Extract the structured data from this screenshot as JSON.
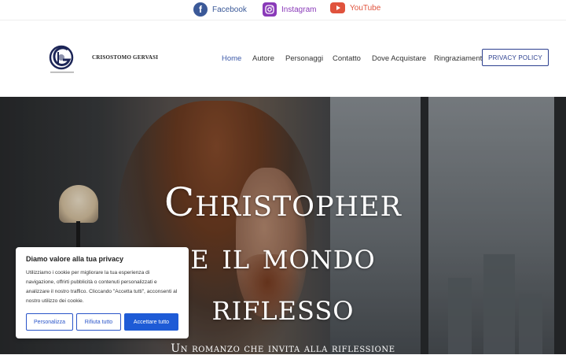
{
  "social": [
    {
      "label": "Facebook",
      "icon": "facebook-icon",
      "color": "#3b5998"
    },
    {
      "label": "Instagram",
      "icon": "instagram-icon",
      "color": "#8a3ab9"
    },
    {
      "label": "YouTube",
      "icon": "youtube-icon",
      "color": "#e0533d"
    }
  ],
  "header": {
    "brand": "CRISOSTOMO GERVASI",
    "nav": [
      "Home",
      "Autore",
      "Personaggi",
      "Contatto",
      "Dove Acquistare",
      "Ringraziamenti"
    ],
    "active_nav": "Home",
    "privacy_button": "PRIVACY POLICY"
  },
  "hero": {
    "title_lines": [
      "Christopher",
      "e il mondo",
      "riflesso"
    ],
    "subtitle": "Un romanzo che invita alla riflessione"
  },
  "cookie": {
    "title": "Diamo valore alla tua privacy",
    "text": "Utilizziamo i cookie per migliorare la tua esperienza di navigazione, offrirti pubblicità o contenuti personalizzati e analizzare il nostro traffico. Cliccando \"Accetta tutti\", acconsenti al nostro utilizzo dei cookie.",
    "customize": "Personalizza",
    "reject": "Rifiuta tutto",
    "accept": "Accettare tutto"
  },
  "colors": {
    "accent": "#3d5aa8",
    "button_primary": "#1e5bd6",
    "privacy_border": "#2b3f8f"
  }
}
